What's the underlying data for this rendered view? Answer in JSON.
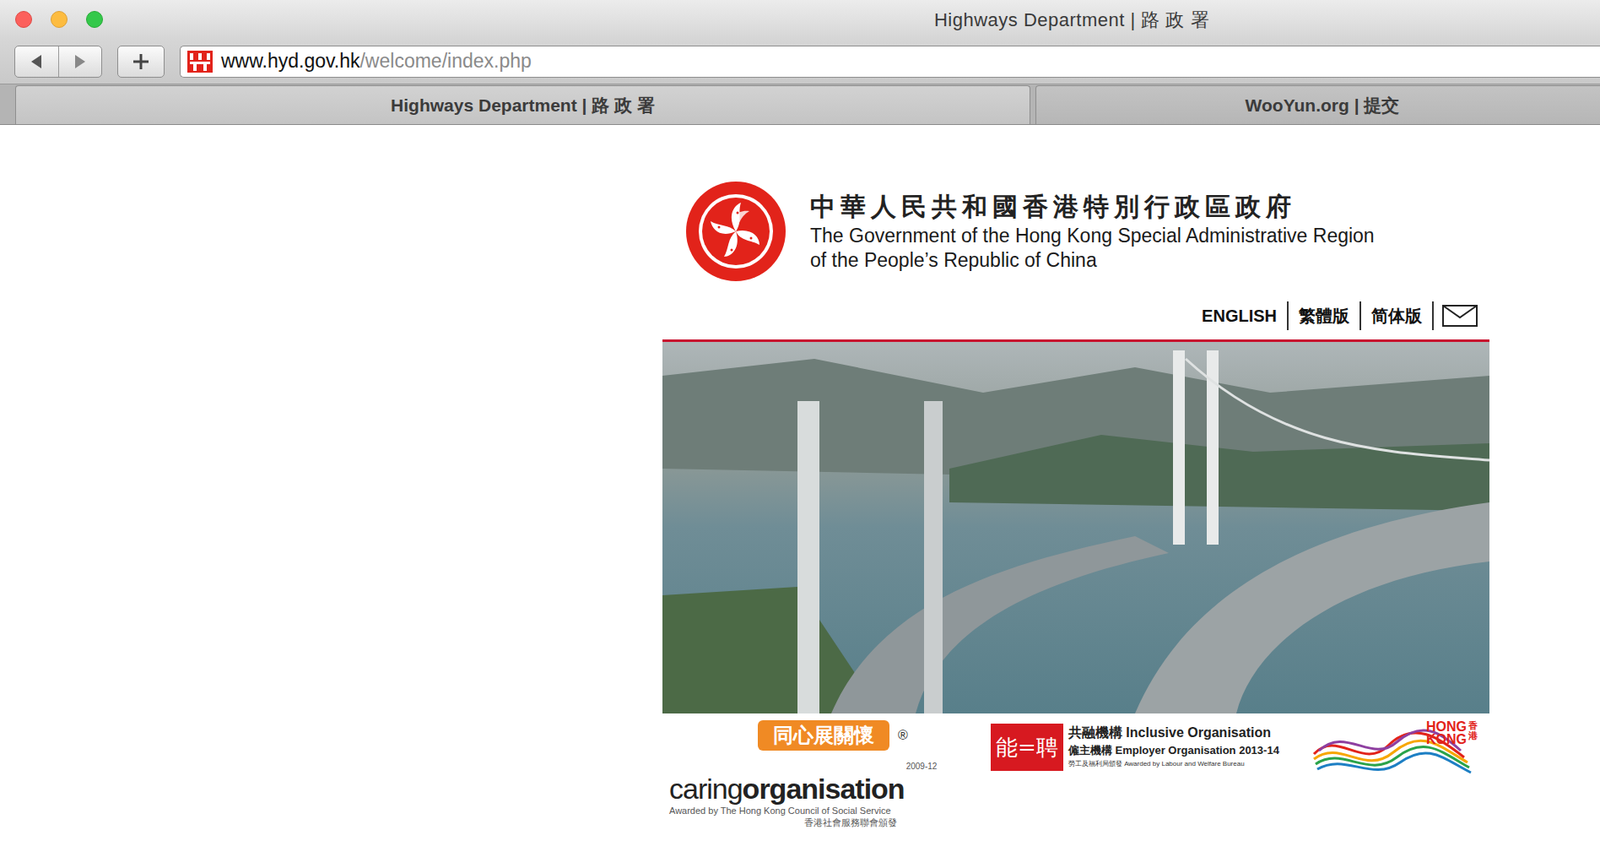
{
  "window": {
    "title": "Highways Department | 路 政 署"
  },
  "toolbar": {
    "url_host": "www.hyd.gov.hk",
    "url_path": "/welcome/index.php"
  },
  "tabs": [
    {
      "label": "Highways Department | 路 政 署",
      "selected": true
    },
    {
      "label": "WooYun.org | 提交",
      "selected": false
    }
  ],
  "page": {
    "gov_zh": "中華人民共和國香港特別行政區政府",
    "gov_en": [
      "The Government of the Hong Kong Special Administrative Region",
      "of the People’s Republic of China"
    ],
    "languages": [
      "ENGLISH",
      "繁體版",
      "简体版"
    ],
    "awards": {
      "caring": {
        "brush": "同心展關懷",
        "word_a": "caring",
        "word_b": "organisation",
        "years": "2009-12",
        "reg": "®",
        "by_en": "Awarded by The Hong Kong Council of Social Service",
        "by_zh": "香港社會服務聯會頒發"
      },
      "inclusive": {
        "mark": "能=聘",
        "line1": "共融機構 Inclusive Organisation",
        "line2": "僱主機構 Employer Organisation 2013-14",
        "line3": "勞工及福利局頒發 Awarded by Labour and Welfare Bureau"
      },
      "brand": {
        "en": "HONG KONG",
        "zh": "香港"
      }
    }
  }
}
